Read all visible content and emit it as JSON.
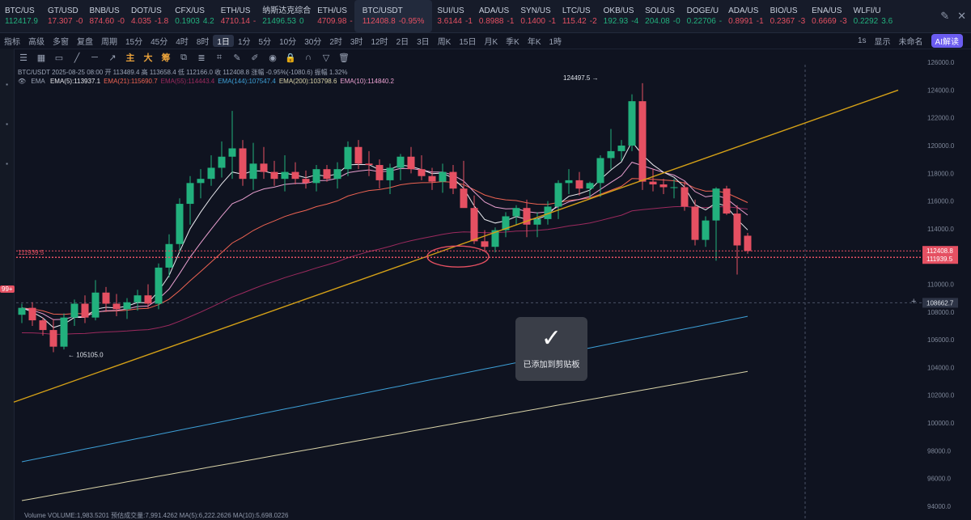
{
  "tickers": [
    {
      "name": "BTC/US",
      "price": "112417.9",
      "chg": "",
      "dir": "up"
    },
    {
      "name": "GT/USD",
      "price": "17.307",
      "chg": "-0",
      "dir": "dn"
    },
    {
      "name": "BNB/US",
      "price": "874.60",
      "chg": "-0",
      "dir": "dn"
    },
    {
      "name": "DOT/US",
      "price": "4.035",
      "chg": "-1.8",
      "dir": "dn"
    },
    {
      "name": "CFX/US",
      "price": "0.1903",
      "chg": "4.2",
      "dir": "up"
    },
    {
      "name": "ETH/US",
      "price": "4710.14",
      "chg": "-",
      "dir": "dn"
    },
    {
      "name": "纳斯达克综合",
      "price": "21496.53",
      "chg": "0",
      "dir": "up"
    },
    {
      "name": "ETH/US",
      "price": "4709.98",
      "chg": "-",
      "dir": "dn"
    },
    {
      "name": "BTC/USDT",
      "price": "112408.8",
      "chg": "-0.95%",
      "dir": "dn",
      "active": true
    },
    {
      "name": "SUI/US",
      "price": "3.6144",
      "chg": "-1",
      "dir": "dn"
    },
    {
      "name": "ADA/US",
      "price": "0.8988",
      "chg": "-1",
      "dir": "dn"
    },
    {
      "name": "SYN/US",
      "price": "0.1400",
      "chg": "-1",
      "dir": "dn"
    },
    {
      "name": "LTC/US",
      "price": "115.42",
      "chg": "-2",
      "dir": "dn"
    },
    {
      "name": "OKB/US",
      "price": "192.93",
      "chg": "-4",
      "dir": "up"
    },
    {
      "name": "SOL/US",
      "price": "204.08",
      "chg": "-0",
      "dir": "up"
    },
    {
      "name": "DOGE/U",
      "price": "0.22706",
      "chg": "-",
      "dir": "up"
    },
    {
      "name": "ADA/US",
      "price": "0.8991",
      "chg": "-1",
      "dir": "dn"
    },
    {
      "name": "BIO/US",
      "price": "0.2367",
      "chg": "-3",
      "dir": "dn"
    },
    {
      "name": "ENA/US",
      "price": "0.6669",
      "chg": "-3",
      "dir": "dn"
    },
    {
      "name": "WLFI/U",
      "price": "0.2292",
      "chg": "3.6",
      "dir": "up"
    }
  ],
  "menu": {
    "items": [
      "指标",
      "高级",
      "多窗",
      "复盘",
      "周期",
      "15分",
      "45分",
      "4时",
      "8时",
      "1日",
      "1分",
      "5分",
      "10分",
      "30分",
      "2时",
      "3时",
      "12时",
      "2日",
      "3日",
      "周K",
      "15日",
      "月K",
      "季K",
      "年K",
      "1時"
    ],
    "selected": "1日",
    "right": {
      "interval": "1s",
      "display": "显示",
      "name": "未命名",
      "ai": "AI解读"
    }
  },
  "tools": [
    "主",
    "大",
    "筹"
  ],
  "info": {
    "line1": "BTC/USDT  2025-08-25 08:00  开 113489.4  高 113658.4  低 112166.0  收 112408.8  涨幅 -0.95%(-1080.6)  振幅 1.32%",
    "ema_label": "EMA",
    "emas": [
      {
        "text": "EMA(5):113937.1",
        "color": "#e9e9ee"
      },
      {
        "text": "EMA(21):115690.7",
        "color": "#ee6352"
      },
      {
        "text": "EMA(55):114443.4",
        "color": "#9c2a5e"
      },
      {
        "text": "EMA(144):107547.4",
        "color": "#3d9fd6"
      },
      {
        "text": "EMA(200):103798.6",
        "color": "#d9d3a8"
      },
      {
        "text": "EMA(10):114840.2",
        "color": "#e9a0d0"
      }
    ]
  },
  "volume": "Volume  VOLUME:1,983.5201  预估成交量:7,991.4262  MA(5):6,222.2626  MA(10):5,698.0226",
  "toast": {
    "message": "已添加到剪贴板"
  },
  "price_axis": {
    "ticks": [
      "126000.0",
      "124000.0",
      "122000.0",
      "120000.0",
      "118000.0",
      "116000.0",
      "114000.0",
      "112000.0",
      "110000.0",
      "108000.0",
      "106000.0",
      "104000.0",
      "102000.0",
      "100000.0",
      "98000.0",
      "96000.0",
      "94000.0"
    ],
    "last_price": "112408.8",
    "mark_price": "111939.5",
    "cursor_price": "108662.7",
    "left_mark": "111939.5"
  },
  "annotations": {
    "high": "124497.5",
    "low": "105105.0"
  },
  "chart_data": {
    "type": "candlestick",
    "candles": [
      [
        107800,
        108600,
        107200,
        108300
      ],
      [
        108300,
        108700,
        107000,
        107400
      ],
      [
        107400,
        107600,
        106300,
        106700
      ],
      [
        106700,
        107500,
        105100,
        105500
      ],
      [
        105500,
        107900,
        105300,
        107600
      ],
      [
        107600,
        108900,
        107000,
        108600
      ],
      [
        108600,
        109200,
        107200,
        107600
      ],
      [
        107600,
        110300,
        107400,
        109400
      ],
      [
        109400,
        109800,
        108000,
        108600
      ],
      [
        108600,
        109300,
        107700,
        108200
      ],
      [
        108200,
        109000,
        107500,
        108700
      ],
      [
        108700,
        109600,
        108100,
        109200
      ],
      [
        109200,
        110000,
        108300,
        108600
      ],
      [
        108600,
        111500,
        108200,
        111200
      ],
      [
        111200,
        113600,
        110500,
        112900
      ],
      [
        112900,
        116200,
        112300,
        115800
      ],
      [
        115800,
        117800,
        114300,
        117300
      ],
      [
        117300,
        118300,
        116200,
        117600
      ],
      [
        117600,
        119300,
        117100,
        118400
      ],
      [
        118400,
        120300,
        117700,
        119200
      ],
      [
        119200,
        122500,
        117600,
        119800
      ],
      [
        119800,
        120400,
        117100,
        117600
      ],
      [
        117600,
        120200,
        116800,
        118700
      ],
      [
        118700,
        119900,
        117600,
        118100
      ],
      [
        118100,
        118900,
        117100,
        117600
      ],
      [
        117600,
        119300,
        116700,
        118100
      ],
      [
        118100,
        118800,
        117200,
        117600
      ],
      [
        117600,
        118200,
        116900,
        117300
      ],
      [
        117300,
        118600,
        116700,
        118300
      ],
      [
        118300,
        118600,
        117400,
        117600
      ],
      [
        117600,
        118800,
        116900,
        118300
      ],
      [
        118300,
        120300,
        117800,
        119900
      ],
      [
        119900,
        120400,
        118300,
        118700
      ],
      [
        118700,
        119600,
        117800,
        118600
      ],
      [
        118600,
        119000,
        116900,
        117500
      ],
      [
        117500,
        118700,
        116500,
        118400
      ],
      [
        118400,
        119400,
        117500,
        119200
      ],
      [
        119200,
        119900,
        118000,
        118300
      ],
      [
        118300,
        119300,
        117500,
        117800
      ],
      [
        117800,
        118400,
        116800,
        117400
      ],
      [
        117400,
        118700,
        116600,
        118100
      ],
      [
        118100,
        118600,
        116500,
        116900
      ],
      [
        116900,
        118900,
        115600,
        115500
      ],
      [
        115500,
        116400,
        112900,
        113100
      ],
      [
        113100,
        113900,
        112400,
        112700
      ],
      [
        112700,
        114100,
        112300,
        113900
      ],
      [
        113900,
        115200,
        113400,
        114900
      ],
      [
        114900,
        115700,
        114300,
        115500
      ],
      [
        115500,
        116100,
        113400,
        114300
      ],
      [
        114300,
        115200,
        113400,
        114700
      ],
      [
        114700,
        116000,
        114300,
        115600
      ],
      [
        115600,
        117500,
        114700,
        117300
      ],
      [
        117300,
        118300,
        116500,
        117500
      ],
      [
        117500,
        118100,
        116400,
        116900
      ],
      [
        116900,
        117400,
        116200,
        117300
      ],
      [
        117300,
        119300,
        116300,
        119100
      ],
      [
        119100,
        121200,
        118300,
        119600
      ],
      [
        119600,
        120400,
        118900,
        120000
      ],
      [
        120000,
        123700,
        119600,
        123200
      ],
      [
        123200,
        124500,
        116800,
        117400
      ],
      [
        117400,
        118300,
        116700,
        117200
      ],
      [
        117200,
        117600,
        116500,
        117000
      ],
      [
        117000,
        117600,
        116200,
        117000
      ],
      [
        117000,
        117400,
        115300,
        115600
      ],
      [
        115600,
        116100,
        112800,
        113200
      ],
      [
        113200,
        114900,
        112700,
        114600
      ],
      [
        114600,
        117000,
        111700,
        116900
      ],
      [
        116900,
        117100,
        115000,
        115100
      ],
      [
        115100,
        115700,
        110700,
        112800
      ],
      [
        113500,
        113700,
        112200,
        112400
      ]
    ],
    "ylim": [
      93000,
      127000
    ],
    "trendline": {
      "from": [
        0,
        101500
      ],
      "to": [
        78,
        124000
      ]
    }
  }
}
